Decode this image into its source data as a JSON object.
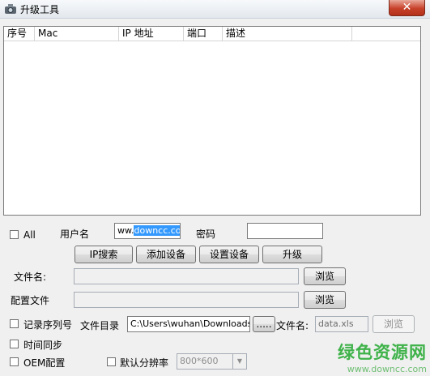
{
  "window": {
    "title": "升级工具",
    "close_glyph": "✕"
  },
  "device_list": {
    "columns": [
      "序号",
      "Mac",
      "IP 地址",
      "端口",
      "描述"
    ],
    "rows": []
  },
  "credentials": {
    "all_label": "All",
    "all_checked": false,
    "username_label": "用户名",
    "username_prefix": "ww.",
    "username_selected": "downcc.com",
    "password_label": "密码",
    "password_value": ""
  },
  "actions": {
    "ip_search": "IP搜索",
    "add_device": "添加设备",
    "configure_device": "设置设备",
    "upgrade": "升级"
  },
  "file": {
    "label": "文件名:",
    "value": "",
    "browse": "浏览"
  },
  "config_file": {
    "label": "配置文件",
    "value": "",
    "browse": "浏览"
  },
  "serial_log": {
    "checkbox_label": "记录序列号",
    "checked": false,
    "dir_label": "文件目录",
    "dir_value": "C:\\Users\\wuhan\\Downloads\\",
    "dir_browse": ".....",
    "filename_label": "文件名:",
    "filename_value": "data.xls",
    "filename_browse": "浏览"
  },
  "time_sync": {
    "label": "时间同步",
    "checked": false
  },
  "oem": {
    "label": "OEM配置",
    "checked": false
  },
  "resolution": {
    "label": "默认分辨率",
    "checked": false,
    "value": "800*600"
  },
  "watermark": {
    "main": "绿色资源网",
    "sub": "www.downcc.com"
  }
}
